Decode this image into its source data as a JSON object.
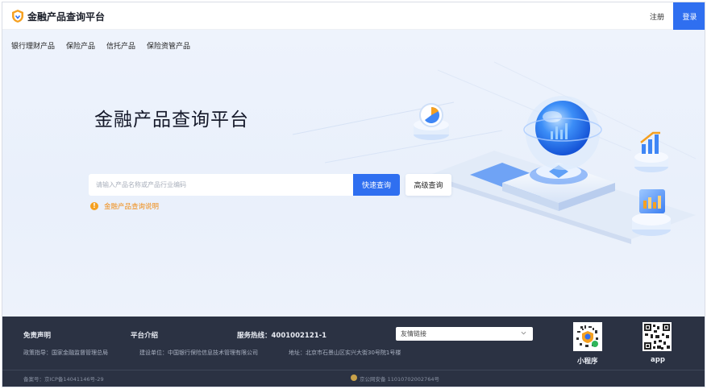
{
  "header": {
    "logo_text": "金融产品查询平台",
    "register": "注册",
    "login": "登录"
  },
  "nav": {
    "items": [
      "银行理财产品",
      "保险产品",
      "信托产品",
      "保险资管产品"
    ]
  },
  "hero": {
    "title": "金融产品查询平台",
    "search_placeholder": "请输入产品名称或产品行业编码",
    "search_button": "快速查询",
    "advanced_button": "高级查询",
    "notice_link": "金融产品查询说明"
  },
  "footer": {
    "disclaimer": "免责声明",
    "platform_intro": "平台介绍",
    "hotline": "服务热线：4001002121-1",
    "guidance": "政策指导：国家金融监督管理总局",
    "builder": "建设单位：中国银行保险信息技术管理有限公司",
    "address": "地址：北京市石景山区实兴大街30号院1号楼",
    "friend_links": "友情链接",
    "miniprogram": "小程序",
    "app": "app",
    "icp": "备案号：京ICP备14041146号-29",
    "police": "京公网安备 11010702002764号"
  },
  "colors": {
    "primary": "#2f6ff0",
    "footer_bg": "#2b3243",
    "notice": "#f08c16"
  }
}
